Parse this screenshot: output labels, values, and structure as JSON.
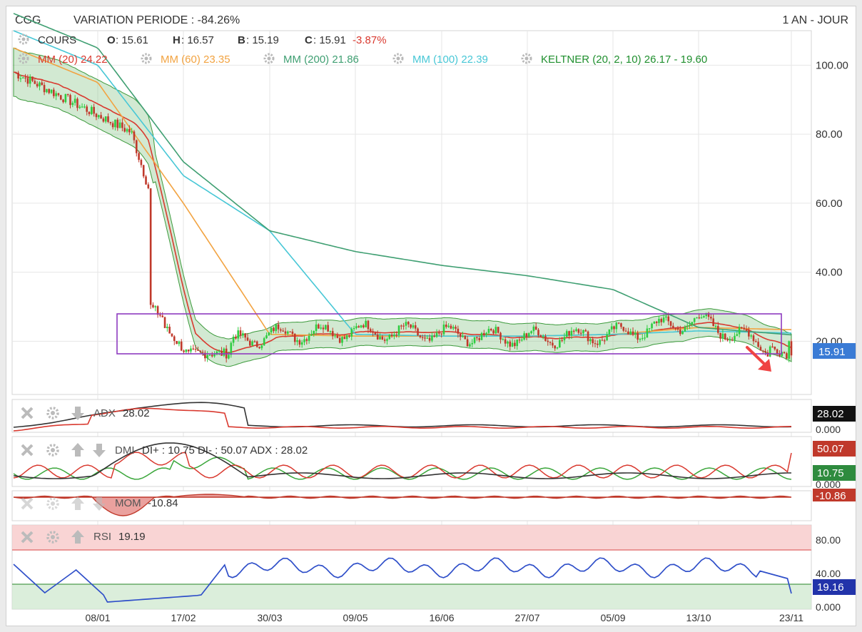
{
  "header": {
    "symbol": "CGG",
    "variation": "VARIATION PERIODE : -84.26%",
    "period": "1 AN - JOUR"
  },
  "legend": {
    "cours": {
      "label": "COURS",
      "o_label": "O",
      "o": ": 15.61",
      "h_label": "H",
      "h": ": 16.57",
      "b_label": "B",
      "b": ": 15.19",
      "c_label": "C",
      "c": ": 15.91",
      "change": "-3.87%"
    },
    "indicators": [
      {
        "label": "MM (20)",
        "value": "24.22",
        "color": "#d9392f"
      },
      {
        "label": "MM (60)",
        "value": "23.35",
        "color": "#f2a341"
      },
      {
        "label": "MM (200)",
        "value": "21.86",
        "color": "#3f9f72"
      },
      {
        "label": "MM (100)",
        "value": "22.39",
        "color": "#47c7d6"
      },
      {
        "label": "KELTNER (20, 2, 10)",
        "value": "26.17 - 19.60",
        "color": "#1f8f2e"
      }
    ]
  },
  "price_axis": {
    "ticks": [
      "100.00",
      "80.00",
      "60.00",
      "40.00",
      "20.00"
    ],
    "current": "15.91"
  },
  "x_axis": {
    "labels": [
      "08/01",
      "17/02",
      "30/03",
      "09/05",
      "16/06",
      "27/07",
      "05/09",
      "13/10",
      "23/11"
    ]
  },
  "adx_panel": {
    "label": "ADX",
    "value": "28.02",
    "badge": "28.02",
    "zero": "0.000"
  },
  "dmi_panel": {
    "label": "DMI",
    "text": "DI+ : 10.75 DI- : 50.07 ADX : 28.02",
    "badge_minus": "50.07",
    "badge_plus": "10.75",
    "zero": "0.000"
  },
  "mom_panel": {
    "label": "MOM",
    "value": "-10.84",
    "badge": "-10.86"
  },
  "rsi_panel": {
    "label": "RSI",
    "value": "19.19",
    "badge": "19.16",
    "ticks": [
      "80.00",
      "40.00",
      "0.000"
    ]
  },
  "colors": {
    "up": "#2ecc40",
    "down": "#c0392b",
    "accent": "#3a7bd5",
    "rsi": "#2f4fc9",
    "box": "#8e3bbf"
  },
  "chart_data": {
    "type": "line",
    "title": "CGG",
    "xlabel": "",
    "ylabel": "",
    "ylim": [
      5,
      110
    ],
    "x": [
      "08/01",
      "17/02",
      "30/03",
      "09/05",
      "16/06",
      "27/07",
      "05/09",
      "13/10",
      "23/11"
    ],
    "series": [
      {
        "name": "COURS",
        "values": [
          82,
          16,
          22,
          23,
          22,
          21,
          22,
          26,
          15.91
        ]
      },
      {
        "name": "MM (20)",
        "values": [
          85,
          18,
          21,
          22,
          21.5,
          21.5,
          22,
          25,
          24.22
        ]
      },
      {
        "name": "MM (60)",
        "values": [
          95,
          60,
          22,
          21.5,
          21.5,
          21.5,
          22,
          24,
          23.35
        ]
      },
      {
        "name": "MM (100)",
        "values": [
          100,
          68,
          52,
          22,
          21.5,
          21.5,
          22,
          23,
          22.39
        ]
      },
      {
        "name": "MM (200)",
        "values": [
          105,
          72,
          52,
          46,
          42,
          39,
          35,
          24,
          21.86
        ]
      }
    ]
  }
}
